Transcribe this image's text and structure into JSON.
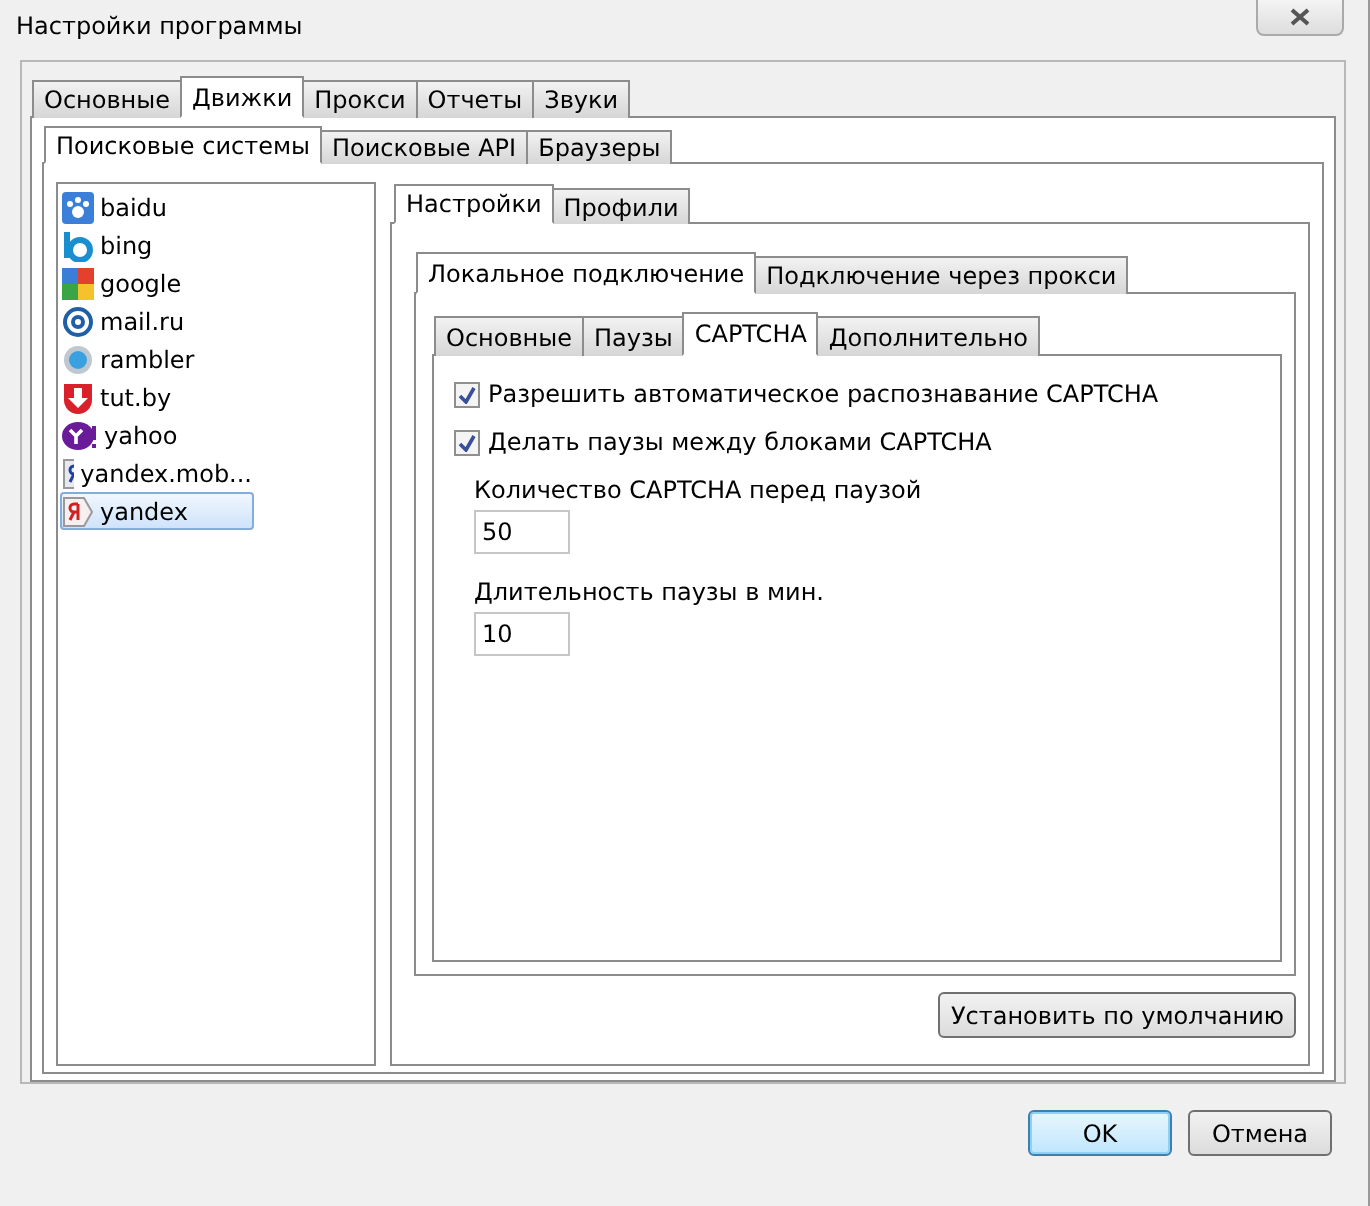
{
  "window": {
    "title": "Настройки программы"
  },
  "main_tabs": [
    {
      "label": "Основные",
      "selected": false
    },
    {
      "label": "Движки",
      "selected": true
    },
    {
      "label": "Прокси",
      "selected": false
    },
    {
      "label": "Отчеты",
      "selected": false
    },
    {
      "label": "Звуки",
      "selected": false
    }
  ],
  "engine_tabs": [
    {
      "label": "Поисковые системы",
      "selected": true
    },
    {
      "label": "Поисковые API",
      "selected": false
    },
    {
      "label": "Браузеры",
      "selected": false
    }
  ],
  "engines": [
    {
      "name": "baidu",
      "selected": false
    },
    {
      "name": "bing",
      "selected": false
    },
    {
      "name": "google",
      "selected": false
    },
    {
      "name": "mail.ru",
      "selected": false
    },
    {
      "name": "rambler",
      "selected": false
    },
    {
      "name": "tut.by",
      "selected": false
    },
    {
      "name": "yahoo",
      "selected": false
    },
    {
      "name": "yandex.mob...",
      "selected": false
    },
    {
      "name": "yandex",
      "selected": true
    }
  ],
  "settings_tabs": [
    {
      "label": "Настройки",
      "selected": true
    },
    {
      "label": "Профили",
      "selected": false
    }
  ],
  "connection_tabs": [
    {
      "label": "Локальное подключение",
      "selected": true
    },
    {
      "label": "Подключение через прокси",
      "selected": false
    }
  ],
  "section_tabs": [
    {
      "label": "Основные",
      "selected": false
    },
    {
      "label": "Паузы",
      "selected": false
    },
    {
      "label": "CAPTCHA",
      "selected": true
    },
    {
      "label": "Дополнительно",
      "selected": false
    }
  ],
  "options": [
    {
      "label": "Разрешить автоматическое распознавание CAPTCHA",
      "checked": true
    },
    {
      "label": "Делать паузы между блоками CAPTCHA",
      "checked": true
    }
  ],
  "fields": [
    {
      "label": "Количество CAPTCHA перед паузой",
      "value": "50"
    },
    {
      "label": "Длительность паузы в мин.",
      "value": "10"
    }
  ],
  "default_button": "Установить по умолчанию",
  "buttons": [
    {
      "label": "OK",
      "kind": "primary"
    },
    {
      "label": "Отмена",
      "kind": "normal"
    }
  ]
}
